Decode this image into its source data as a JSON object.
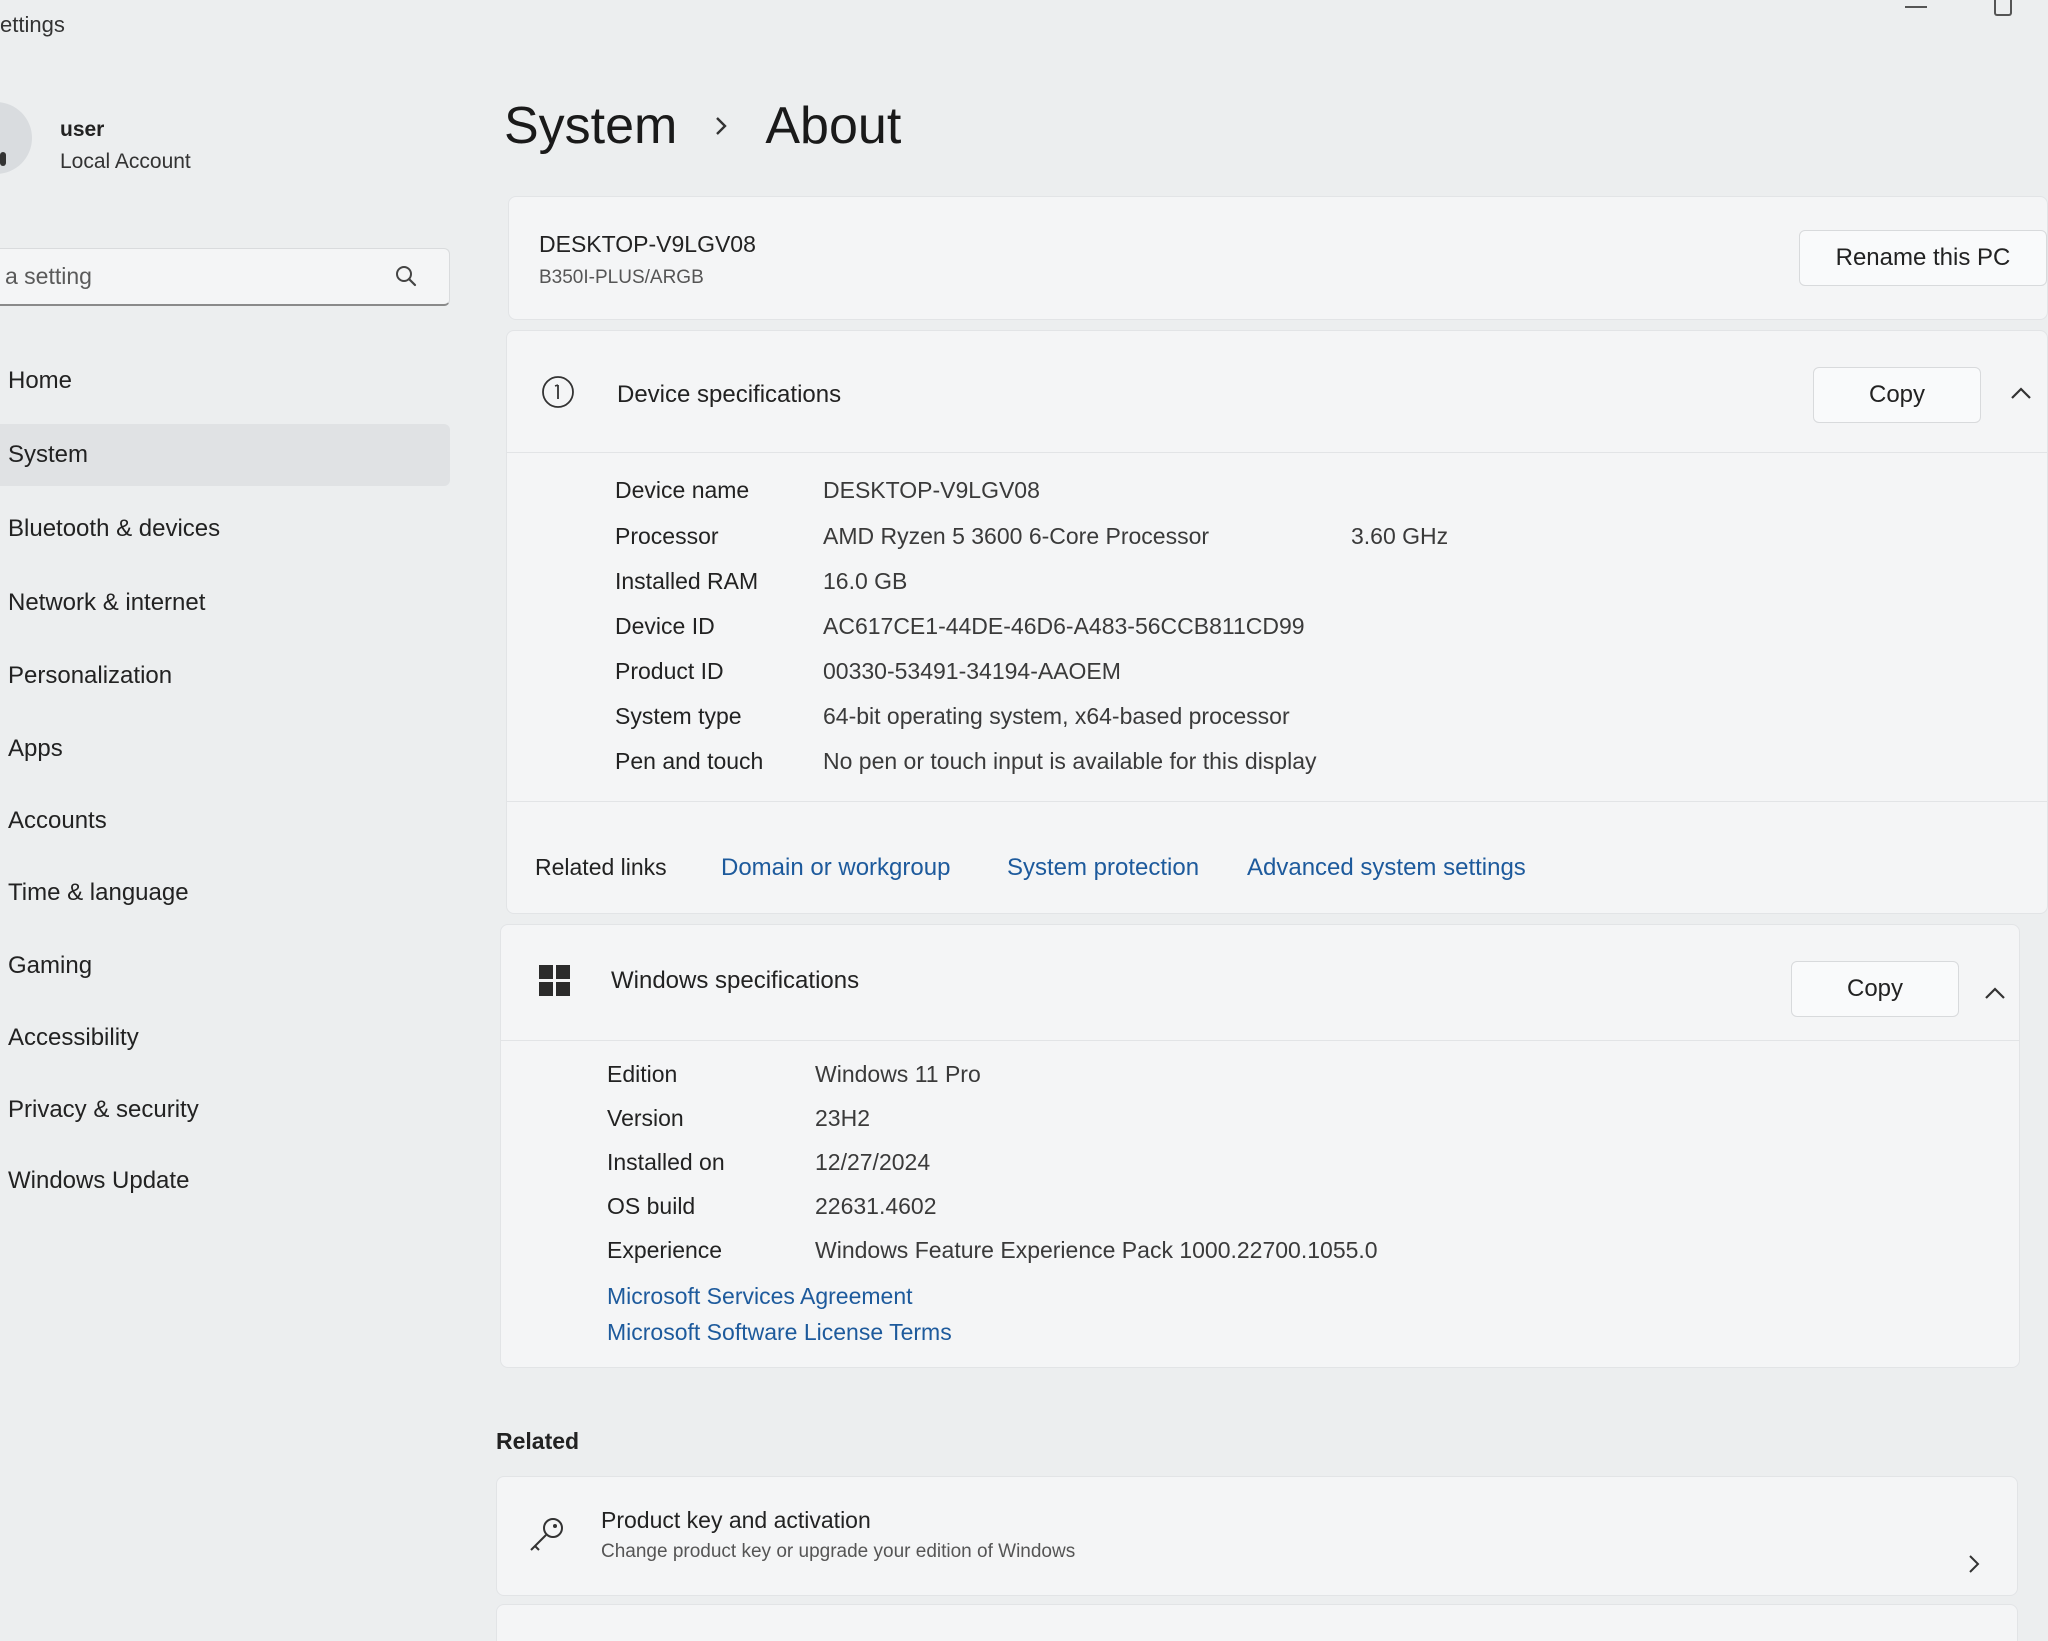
{
  "app_title": "ettings",
  "user": {
    "name": "user",
    "account_type": "Local Account"
  },
  "search": {
    "placeholder": "a setting"
  },
  "nav": [
    {
      "label": "Home"
    },
    {
      "label": "System",
      "active": true
    },
    {
      "label": "Bluetooth & devices"
    },
    {
      "label": "Network & internet"
    },
    {
      "label": "Personalization"
    },
    {
      "label": "Apps"
    },
    {
      "label": "Accounts"
    },
    {
      "label": "Time & language"
    },
    {
      "label": "Gaming"
    },
    {
      "label": "Accessibility"
    },
    {
      "label": "Privacy & security"
    },
    {
      "label": "Windows Update"
    }
  ],
  "breadcrumb": {
    "parent": "System",
    "current": "About"
  },
  "pc": {
    "name": "DESKTOP-V9LGV08",
    "model": "B350I-PLUS/ARGB",
    "rename_label": "Rename this PC"
  },
  "device_specs": {
    "title": "Device specifications",
    "copy_label": "Copy",
    "rows": [
      {
        "label": "Device name",
        "value": "DESKTOP-V9LGV08"
      },
      {
        "label": "Processor",
        "value": "AMD Ryzen 5 3600 6-Core Processor",
        "extra": "3.60 GHz"
      },
      {
        "label": "Installed RAM",
        "value": "16.0 GB"
      },
      {
        "label": "Device ID",
        "value": "AC617CE1-44DE-46D6-A483-56CCB811CD99"
      },
      {
        "label": "Product ID",
        "value": "00330-53491-34194-AAOEM"
      },
      {
        "label": "System type",
        "value": "64-bit operating system, x64-based processor"
      },
      {
        "label": "Pen and touch",
        "value": "No pen or touch input is available for this display"
      }
    ]
  },
  "related_links": {
    "label": "Related links",
    "links": [
      "Domain or workgroup",
      "System protection",
      "Advanced system settings"
    ]
  },
  "windows_specs": {
    "title": "Windows specifications",
    "copy_label": "Copy",
    "rows": [
      {
        "label": "Edition",
        "value": "Windows 11 Pro"
      },
      {
        "label": "Version",
        "value": "23H2"
      },
      {
        "label": "Installed on",
        "value": "12/27/2024"
      },
      {
        "label": "OS build",
        "value": "22631.4602"
      },
      {
        "label": "Experience",
        "value": "Windows Feature Experience Pack 1000.22700.1055.0"
      }
    ],
    "links": [
      "Microsoft Services Agreement",
      "Microsoft Software License Terms"
    ]
  },
  "related": {
    "heading": "Related",
    "product_key": {
      "title": "Product key and activation",
      "subtitle": "Change product key or upgrade your edition of Windows"
    }
  },
  "colors": {
    "link": "#1d5a9c",
    "background": "#eceeef",
    "card": "#f4f5f6"
  },
  "icons": [
    "search-icon",
    "info-icon",
    "chevron-up-icon",
    "windows-logo-icon",
    "key-icon",
    "chevron-right-icon",
    "minimize-icon",
    "maximize-icon"
  ]
}
